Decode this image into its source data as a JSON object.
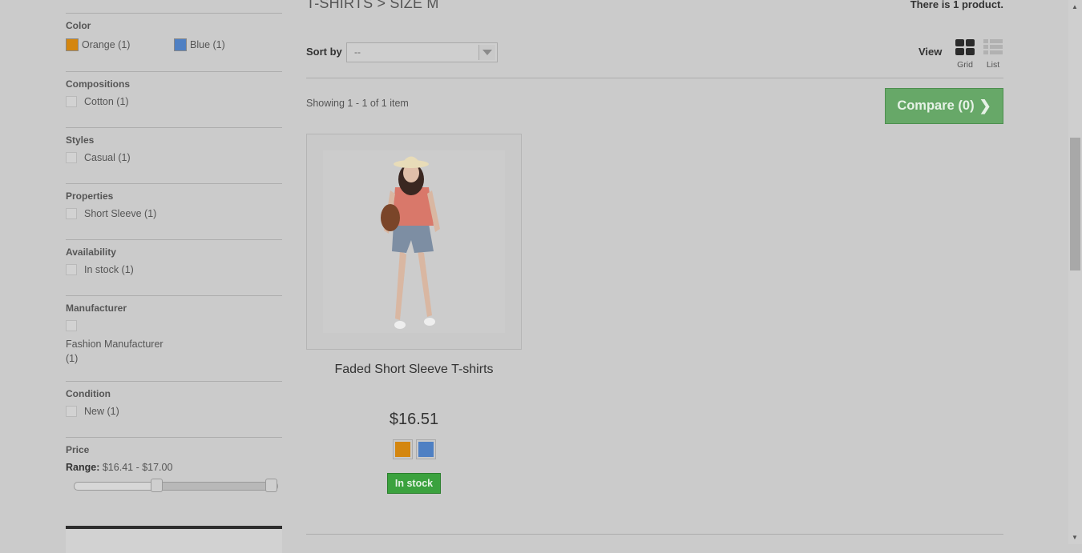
{
  "category": {
    "title": "T-SHIRTS > SIZE M",
    "product_count": "There is 1 product."
  },
  "filters": {
    "color": {
      "title": "Color",
      "options": [
        {
          "label": "Orange (1)",
          "swatch": "#d4860f"
        },
        {
          "label": "Blue (1)",
          "swatch": "#4f80c3"
        }
      ]
    },
    "compositions": {
      "title": "Compositions",
      "options": [
        {
          "label": "Cotton (1)"
        }
      ]
    },
    "styles": {
      "title": "Styles",
      "options": [
        {
          "label": "Casual (1)"
        }
      ]
    },
    "properties": {
      "title": "Properties",
      "options": [
        {
          "label": "Short Sleeve (1)"
        }
      ]
    },
    "availability": {
      "title": "Availability",
      "options": [
        {
          "label": "In stock (1)"
        }
      ]
    },
    "manufacturer": {
      "title": "Manufacturer",
      "options": [
        {
          "label": "Fashion Manufacturer",
          "label2": "(1)"
        }
      ]
    },
    "condition": {
      "title": "Condition",
      "options": [
        {
          "label": "New (1)"
        }
      ]
    },
    "price": {
      "title": "Price",
      "range_label": "Range:",
      "range_value": "$16.41 - $17.00",
      "slider_min_fraction": 0.4,
      "slider_max_fraction": 1.0
    }
  },
  "toolbar": {
    "sort_label": "Sort by",
    "sort_value": "--",
    "view_label": "View",
    "view_grid": "Grid",
    "view_list": "List",
    "showing": "Showing 1 - 1 of 1 item",
    "compare_label": "Compare (0)"
  },
  "product": {
    "name": "Faded Short Sleeve T-shirts",
    "price": "$16.51",
    "colors": [
      "#d4860f",
      "#4f80c3"
    ],
    "availability": "In stock"
  },
  "colors": {
    "in_stock_green": "#3ba23e",
    "compare_green": "#67a868"
  }
}
